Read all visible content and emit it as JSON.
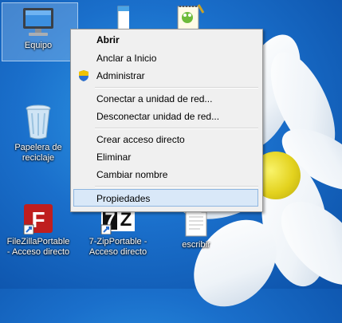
{
  "desktop": {
    "icons": [
      {
        "label": "Equipo"
      },
      {
        "label": ""
      },
      {
        "label": ""
      },
      {
        "label": "Papelera de reciclaje"
      },
      {
        "label": "FileZillaPortable - Acceso directo"
      },
      {
        "label": "7-ZipPortable - Acceso directo"
      },
      {
        "label": "escribir"
      }
    ]
  },
  "menu": {
    "items": [
      {
        "label": "Abrir"
      },
      {
        "label": "Anclar a Inicio"
      },
      {
        "label": "Administrar"
      },
      {
        "label": "Conectar a unidad de red..."
      },
      {
        "label": "Desconectar unidad de red..."
      },
      {
        "label": "Crear acceso directo"
      },
      {
        "label": "Eliminar"
      },
      {
        "label": "Cambiar nombre"
      },
      {
        "label": "Propiedades"
      }
    ]
  },
  "colors": {
    "accent_hover": "#d9e8f8",
    "desktop_blue": "#1a6fcb"
  }
}
